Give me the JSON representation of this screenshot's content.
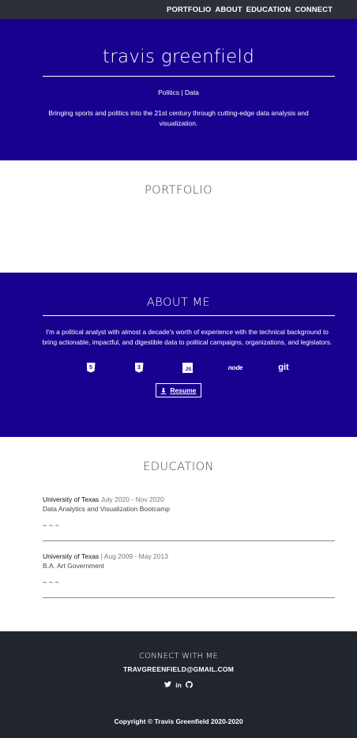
{
  "nav": {
    "items": [
      "PORTFOLIO",
      "ABOUT",
      "EDUCATION",
      "CONNECT"
    ]
  },
  "hero": {
    "name": "travis greenfield",
    "tags": "Politics | Data",
    "tagline": "Bringing sports and politics into the 21st century through cutting-edge data analysis and visualization."
  },
  "portfolio": {
    "title": "PORTFOLIO"
  },
  "about": {
    "title": "ABOUT ME",
    "bio": "I'm a political analyst with almost a decade's worth of experience with the technical background to bring actionable, impactful, and digestible data to political campaigns, organizations, and legislators.",
    "skills": {
      "html_icon": "html5-icon",
      "css_icon": "css3-icon",
      "js_label": "JS",
      "node_label": "node",
      "git_label": "git"
    },
    "resume_label": "Resume"
  },
  "education": {
    "title": "EDUCATION",
    "items": [
      {
        "school": "University of Texas",
        "dates": "July 2020 - Nov 2020",
        "degree": "Data Analytics and Visualization Bootcamp",
        "squiggle": "~ ~ ~"
      },
      {
        "school": "University of Texas",
        "separator": "|",
        "dates": "Aug 2009 - May 2013",
        "degree": "B.A. Art Government",
        "squiggle": "~ ~ ~"
      }
    ]
  },
  "footer": {
    "connect_title": "CONNECT WITH ME",
    "email": "TRAVGREENFIELD@GMAIL.COM",
    "social": {
      "twitter_icon": "twitter-icon",
      "linkedin_label": "in",
      "github_icon": "github-icon"
    },
    "copyright": "Copyright © Travis Greenfield 2020-2020"
  },
  "colors": {
    "nav_bg": "#2d3039",
    "brand_blue": "#1a008f",
    "footer_bg": "#21252e"
  }
}
